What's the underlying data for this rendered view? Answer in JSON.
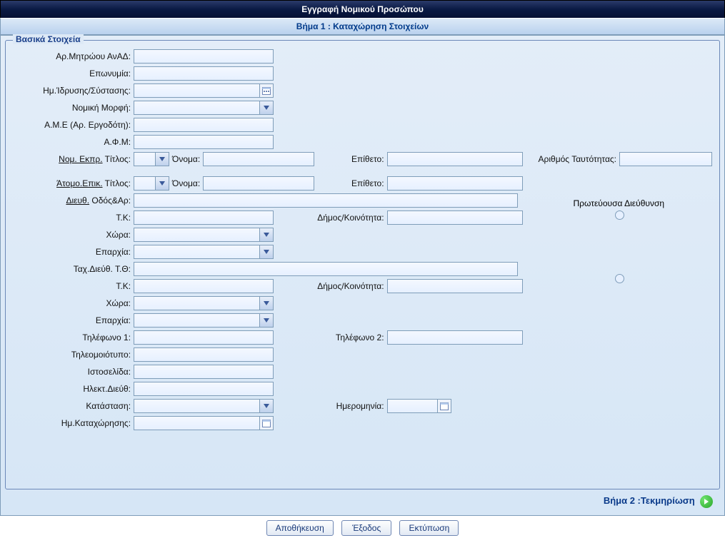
{
  "header": {
    "title": "Εγγραφή Νομικού Προσώπου"
  },
  "step": {
    "label": "Βήμα 1 : Καταχώρηση Στοιχείων"
  },
  "legend": "Βασικά Στοιχεία",
  "labels": {
    "registry": "Αρ.Μητρώου ΑνΑΔ:",
    "name": "Επωνυμία:",
    "founding": "Ημ.Ίδρυσης/Σύστασης:",
    "legalform": "Νομική Μορφή:",
    "employerno": "Α.Μ.Ε (Αρ. Εργοδότη):",
    "taxid": "Α.Φ.Μ:",
    "legalrep": "Νομ. Εκπρ.",
    "title": "Τίτλος:",
    "fname": "Όνομα:",
    "lname": "Επίθετο:",
    "idnum": "Αριθμός Ταυτότητας:",
    "contact": "Άτομο.Επικ.",
    "addr": "Διευθ.",
    "street": "Οδός&Αρ:",
    "postal": "Τ.Κ:",
    "municip": "Δήμος/Κοινότητα:",
    "country": "Χώρα:",
    "district": "Επαρχία:",
    "pobox": "Ταχ.Διεύθ. Τ.Θ:",
    "phone1": "Τηλέφωνο 1:",
    "phone2": "Τηλέφωνο 2:",
    "fax": "Τηλεομοιότυπο:",
    "website": "Ιστοσελίδα:",
    "email": "Ηλεκτ.Διεύθ:",
    "status": "Κατάσταση:",
    "date": "Ημερομηνία:",
    "entrydate": "Ημ.Καταχώρησης:",
    "primaryaddr": "Πρωτεύουσα Διεύθυνση"
  },
  "values": {
    "registry": "",
    "name": "",
    "founding": "",
    "legalform": "",
    "employerno": "",
    "taxid": "",
    "rep_title": "",
    "rep_fname": "",
    "rep_lname": "",
    "rep_id": "",
    "con_title": "",
    "con_fname": "",
    "con_lname": "",
    "addr_street": "",
    "addr_postal": "",
    "addr_municip": "",
    "addr_country": "",
    "addr_district": "",
    "po_box": "",
    "po_postal": "",
    "po_municip": "",
    "po_country": "",
    "po_district": "",
    "phone1": "",
    "phone2": "",
    "fax": "",
    "website": "",
    "email": "",
    "status": "",
    "status_date": "",
    "entrydate": ""
  },
  "footer": {
    "next": "Βήμα 2 :Τεκμηρίωση",
    "save": "Αποθήκευση",
    "exit": "Έξοδος",
    "print": "Εκτύπωση"
  }
}
